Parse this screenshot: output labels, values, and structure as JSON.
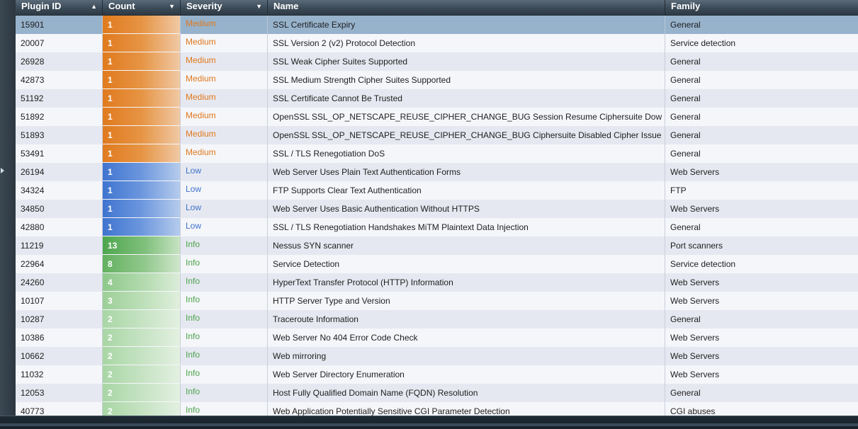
{
  "columns": {
    "plugin_id": "Plugin ID",
    "count": "Count",
    "severity": "Severity",
    "name": "Name",
    "family": "Family"
  },
  "sort_icons": {
    "plugin_id": "▲",
    "count": "▼",
    "severity": "▼"
  },
  "colors": {
    "medium": "#e0781c",
    "low": "#3d73c9",
    "info": "#4aa34a",
    "selected_row": "#97b2cb",
    "header": "#3b4a57"
  },
  "rows": [
    {
      "id": "15901",
      "count": "1",
      "severity": "Medium",
      "name": "SSL Certificate Expiry",
      "family": "General"
    },
    {
      "id": "20007",
      "count": "1",
      "severity": "Medium",
      "name": "SSL Version 2 (v2) Protocol Detection",
      "family": "Service detection"
    },
    {
      "id": "26928",
      "count": "1",
      "severity": "Medium",
      "name": "SSL Weak Cipher Suites Supported",
      "family": "General"
    },
    {
      "id": "42873",
      "count": "1",
      "severity": "Medium",
      "name": "SSL Medium Strength Cipher Suites Supported",
      "family": "General"
    },
    {
      "id": "51192",
      "count": "1",
      "severity": "Medium",
      "name": "SSL Certificate Cannot Be Trusted",
      "family": "General"
    },
    {
      "id": "51892",
      "count": "1",
      "severity": "Medium",
      "name": "OpenSSL SSL_OP_NETSCAPE_REUSE_CIPHER_CHANGE_BUG Session Resume Ciphersuite Dow",
      "family": "General"
    },
    {
      "id": "51893",
      "count": "1",
      "severity": "Medium",
      "name": "OpenSSL SSL_OP_NETSCAPE_REUSE_CIPHER_CHANGE_BUG Ciphersuite Disabled Cipher Issue",
      "family": "General"
    },
    {
      "id": "53491",
      "count": "1",
      "severity": "Medium",
      "name": "SSL / TLS Renegotiation DoS",
      "family": "General"
    },
    {
      "id": "26194",
      "count": "1",
      "severity": "Low",
      "name": "Web Server Uses Plain Text Authentication Forms",
      "family": "Web Servers"
    },
    {
      "id": "34324",
      "count": "1",
      "severity": "Low",
      "name": "FTP Supports Clear Text Authentication",
      "family": "FTP"
    },
    {
      "id": "34850",
      "count": "1",
      "severity": "Low",
      "name": "Web Server Uses Basic Authentication Without HTTPS",
      "family": "Web Servers"
    },
    {
      "id": "42880",
      "count": "1",
      "severity": "Low",
      "name": "SSL / TLS Renegotiation Handshakes MiTM Plaintext Data Injection",
      "family": "General"
    },
    {
      "id": "11219",
      "count": "13",
      "severity": "Info",
      "name": "Nessus SYN scanner",
      "family": "Port scanners"
    },
    {
      "id": "22964",
      "count": "8",
      "severity": "Info",
      "name": "Service Detection",
      "family": "Service detection"
    },
    {
      "id": "24260",
      "count": "4",
      "severity": "Info",
      "name": "HyperText Transfer Protocol (HTTP) Information",
      "family": "Web Servers"
    },
    {
      "id": "10107",
      "count": "3",
      "severity": "Info",
      "name": "HTTP Server Type and Version",
      "family": "Web Servers"
    },
    {
      "id": "10287",
      "count": "2",
      "severity": "Info",
      "name": "Traceroute Information",
      "family": "General"
    },
    {
      "id": "10386",
      "count": "2",
      "severity": "Info",
      "name": "Web Server No 404 Error Code Check",
      "family": "Web Servers"
    },
    {
      "id": "10662",
      "count": "2",
      "severity": "Info",
      "name": "Web mirroring",
      "family": "Web Servers"
    },
    {
      "id": "11032",
      "count": "2",
      "severity": "Info",
      "name": "Web Server Directory Enumeration",
      "family": "Web Servers"
    },
    {
      "id": "12053",
      "count": "2",
      "severity": "Info",
      "name": "Host Fully Qualified Domain Name (FQDN) Resolution",
      "family": "General"
    },
    {
      "id": "40773",
      "count": "2",
      "severity": "Info",
      "name": "Web Application Potentially Sensitive CGI Parameter Detection",
      "family": "CGI abuses"
    }
  ]
}
